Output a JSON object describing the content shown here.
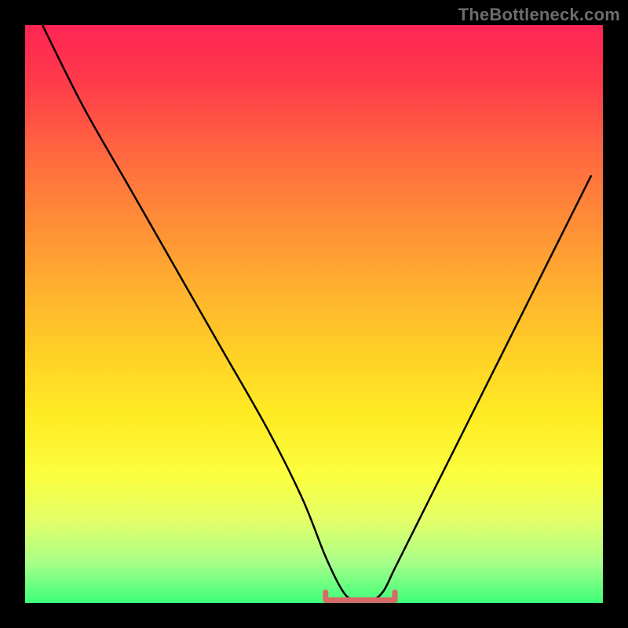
{
  "watermark": "TheBottleneck.com",
  "colors": {
    "page_bg": "#000000",
    "curve": "#000000",
    "marker": "#d86a66",
    "watermark_text": "#6c6c6c"
  },
  "chart_data": {
    "type": "line",
    "title": "",
    "xlabel": "",
    "ylabel": "",
    "xlim": [
      0,
      100
    ],
    "ylim": [
      0,
      100
    ],
    "grid": false,
    "series": [
      {
        "name": "bottleneck-curve",
        "x": [
          3,
          10,
          18,
          26,
          34,
          42,
          48,
          52,
          55,
          57,
          60,
          62,
          64,
          68,
          74,
          82,
          90,
          98
        ],
        "values": [
          100,
          86,
          72,
          58,
          44,
          30,
          18,
          8,
          2,
          0.5,
          0.5,
          2,
          6,
          14,
          26,
          42,
          58,
          74
        ]
      }
    ],
    "marker_region": {
      "x_start": 52,
      "x_end": 64,
      "y": 0.5
    },
    "background_gradient_meaning": "red (top) = high bottleneck, green (bottom) = low bottleneck"
  }
}
